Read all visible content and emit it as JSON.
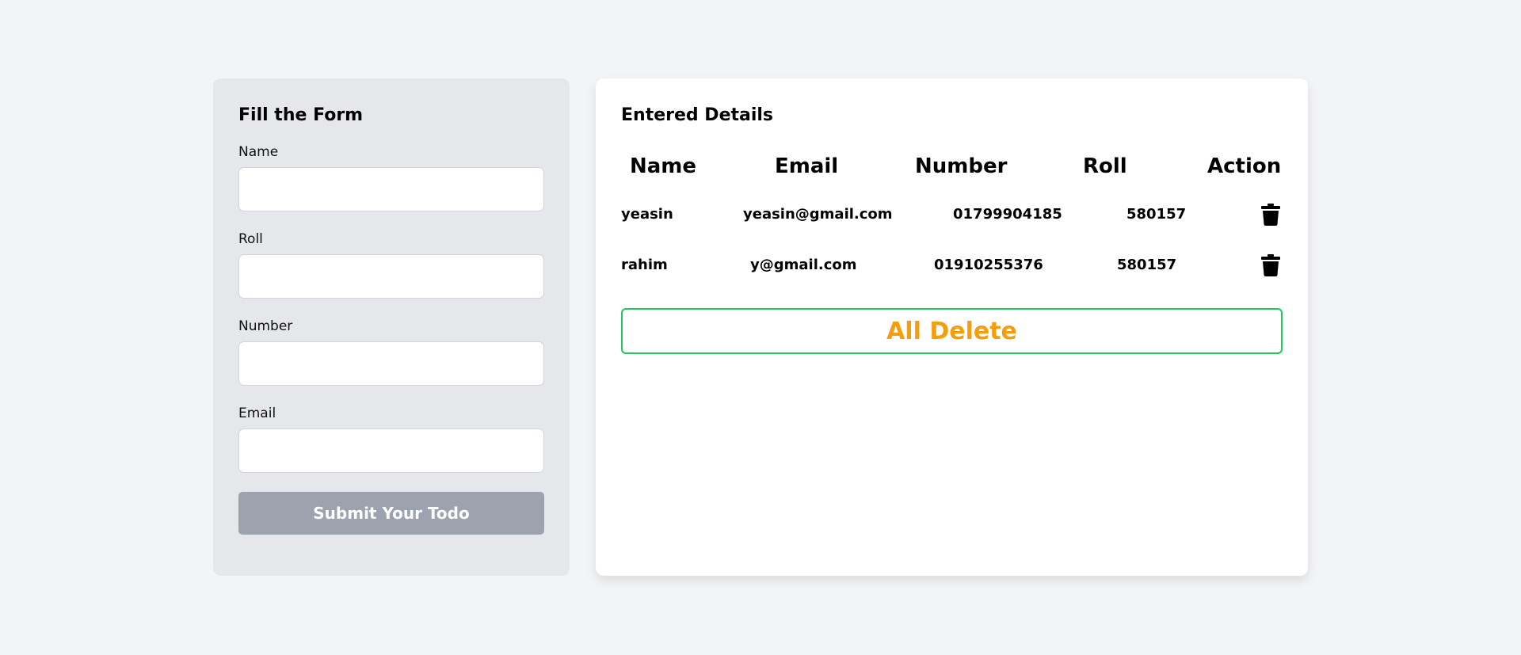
{
  "form": {
    "title": "Fill the Form",
    "fields": [
      {
        "label": "Name",
        "value": "",
        "placeholder": ""
      },
      {
        "label": "Roll",
        "value": "",
        "placeholder": ""
      },
      {
        "label": "Number",
        "value": "",
        "placeholder": ""
      },
      {
        "label": "Email",
        "value": "",
        "placeholder": ""
      }
    ],
    "submit_label": "Submit Your Todo"
  },
  "details": {
    "title": "Entered Details",
    "columns": [
      "Name",
      "Email",
      "Number",
      "Roll",
      "Action"
    ],
    "rows": [
      {
        "name": "yeasin",
        "email": "yeasin@gmail.com",
        "number": "01799904185",
        "roll": "580157",
        "action_icon": "trash-icon"
      },
      {
        "name": "rahim",
        "email": "y@gmail.com",
        "number": "01910255376",
        "roll": "580157",
        "action_icon": "trash-icon"
      }
    ],
    "all_delete_label": "All Delete"
  },
  "colors": {
    "page_bg": "#f3f4f6",
    "form_card_bg": "#e5e7eb",
    "submit_bg": "#9ca3af",
    "all_delete_border": "#22c55e",
    "all_delete_text": "#f59e0b"
  }
}
